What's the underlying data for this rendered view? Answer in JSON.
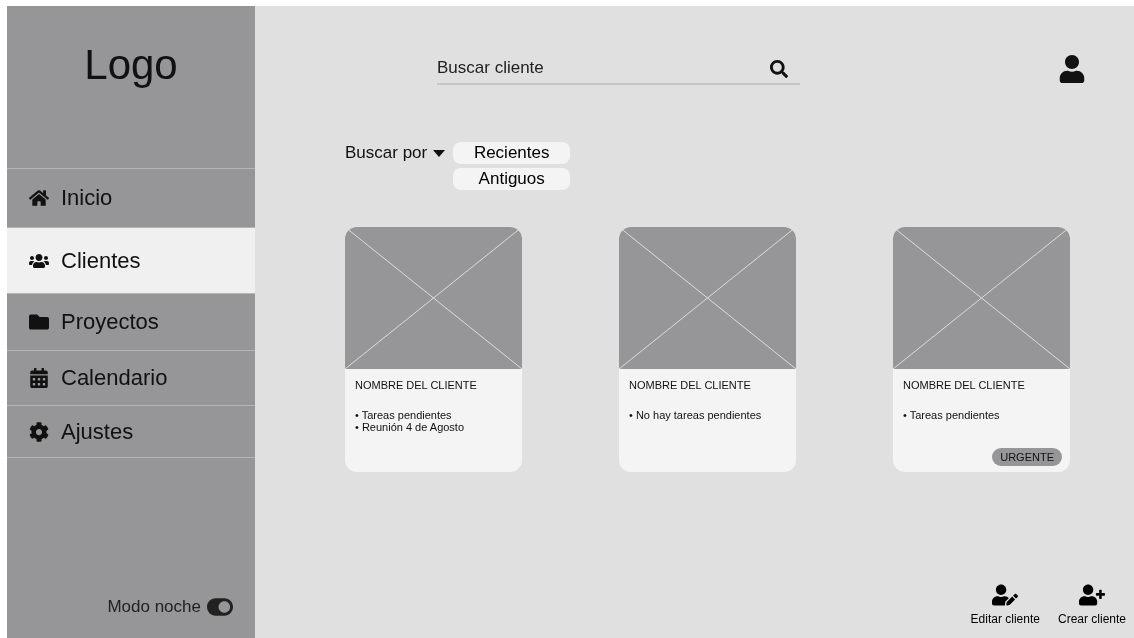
{
  "sidebar": {
    "logo": "Logo",
    "items": [
      {
        "label": "Inicio",
        "kind": "home",
        "selected": false
      },
      {
        "label": "Clientes",
        "kind": "users",
        "selected": true
      },
      {
        "label": "Proyectos",
        "kind": "folder",
        "selected": false
      },
      {
        "label": "Calendario",
        "kind": "calendar",
        "selected": false
      },
      {
        "label": "Ajustes",
        "kind": "settings",
        "selected": false
      }
    ],
    "night_mode": {
      "label": "Modo noche",
      "on": true
    }
  },
  "search": {
    "placeholder": "Buscar cliente"
  },
  "filter": {
    "label": "Buscar por",
    "options": [
      {
        "label": "Recientes",
        "selected": false
      },
      {
        "label": "Antiguos",
        "selected": false
      }
    ]
  },
  "cards": [
    {
      "name": "NOMBRE DEL CLIENTE",
      "notes": [
        "• Tareas pendientes",
        "• Reunión 4 de Agosto"
      ]
    },
    {
      "name": "NOMBRE DEL CLIENTE",
      "notes": [
        "• No hay tareas pendientes"
      ]
    },
    {
      "name": "NOMBRE DEL CLIENTE",
      "notes": [
        "• Tareas pendientes"
      ],
      "badge": "URGENTE"
    }
  ],
  "actions": [
    {
      "label": "Editar cliente",
      "kind": "edit"
    },
    {
      "label": "Crear cliente",
      "kind": "add"
    }
  ]
}
